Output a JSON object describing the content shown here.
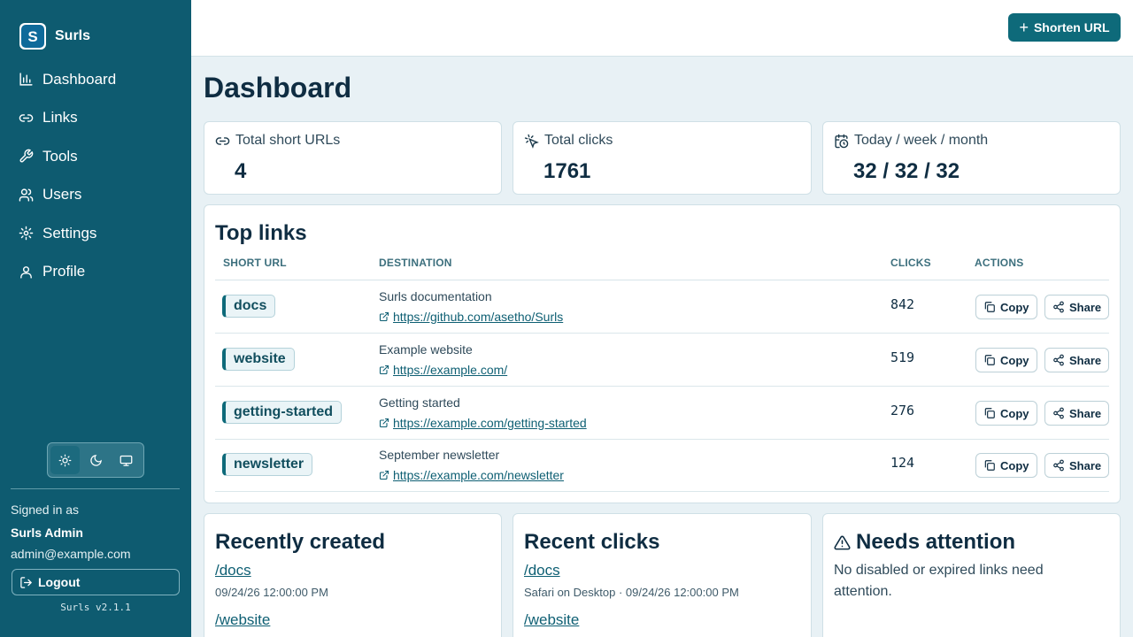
{
  "app": {
    "name": "Surls",
    "version": "Surls v2.1.1"
  },
  "nav": [
    {
      "label": "Dashboard",
      "icon": "bar-chart-icon"
    },
    {
      "label": "Links",
      "icon": "link-icon"
    },
    {
      "label": "Tools",
      "icon": "wrench-icon"
    },
    {
      "label": "Users",
      "icon": "users-icon"
    },
    {
      "label": "Settings",
      "icon": "gear-icon"
    },
    {
      "label": "Profile",
      "icon": "user-icon"
    }
  ],
  "theme": {
    "options": [
      "light",
      "dark",
      "system"
    ],
    "selected": "light"
  },
  "user": {
    "signed_in_label": "Signed in as",
    "name": "Surls Admin",
    "email": "admin@example.com",
    "logout_label": "Logout"
  },
  "header": {
    "shorten_label": "Shorten URL",
    "page_title": "Dashboard"
  },
  "stats": [
    {
      "label": "Total short URLs",
      "value": "4",
      "icon": "link-icon"
    },
    {
      "label": "Total clicks",
      "value": "1761",
      "icon": "cursor-click-icon"
    },
    {
      "label": "Today / week / month",
      "value": "32 / 32 / 32",
      "icon": "calendar-clock-icon"
    }
  ],
  "top_links": {
    "title": "Top links",
    "columns": [
      "SHORT URL",
      "DESTINATION",
      "CLICKS",
      "ACTIONS"
    ],
    "copy_label": "Copy",
    "share_label": "Share",
    "rows": [
      {
        "slug": "docs",
        "title": "Surls documentation",
        "url": "https://github.com/asetho/Surls",
        "clicks": "842"
      },
      {
        "slug": "website",
        "title": "Example website",
        "url": "https://example.com/",
        "clicks": "519"
      },
      {
        "slug": "getting-started",
        "title": "Getting started",
        "url": "https://example.com/getting-started",
        "clicks": "276"
      },
      {
        "slug": "newsletter",
        "title": "September newsletter",
        "url": "https://example.com/newsletter",
        "clicks": "124"
      }
    ]
  },
  "recently_created": {
    "title": "Recently created",
    "items": [
      {
        "path": "/docs",
        "meta": "09/24/26 12:00:00 PM"
      },
      {
        "path": "/website",
        "meta": ""
      }
    ]
  },
  "recent_clicks": {
    "title": "Recent clicks",
    "items": [
      {
        "path": "/docs",
        "meta": "Safari on Desktop · 09/24/26 12:00:00 PM"
      },
      {
        "path": "/website",
        "meta": ""
      }
    ]
  },
  "needs_attention": {
    "title": "Needs attention",
    "text": "No disabled or expired links need attention."
  },
  "colors": {
    "sidebar": "#0e5b70",
    "accent": "#0e6a7a",
    "background": "#e8f1f5"
  }
}
